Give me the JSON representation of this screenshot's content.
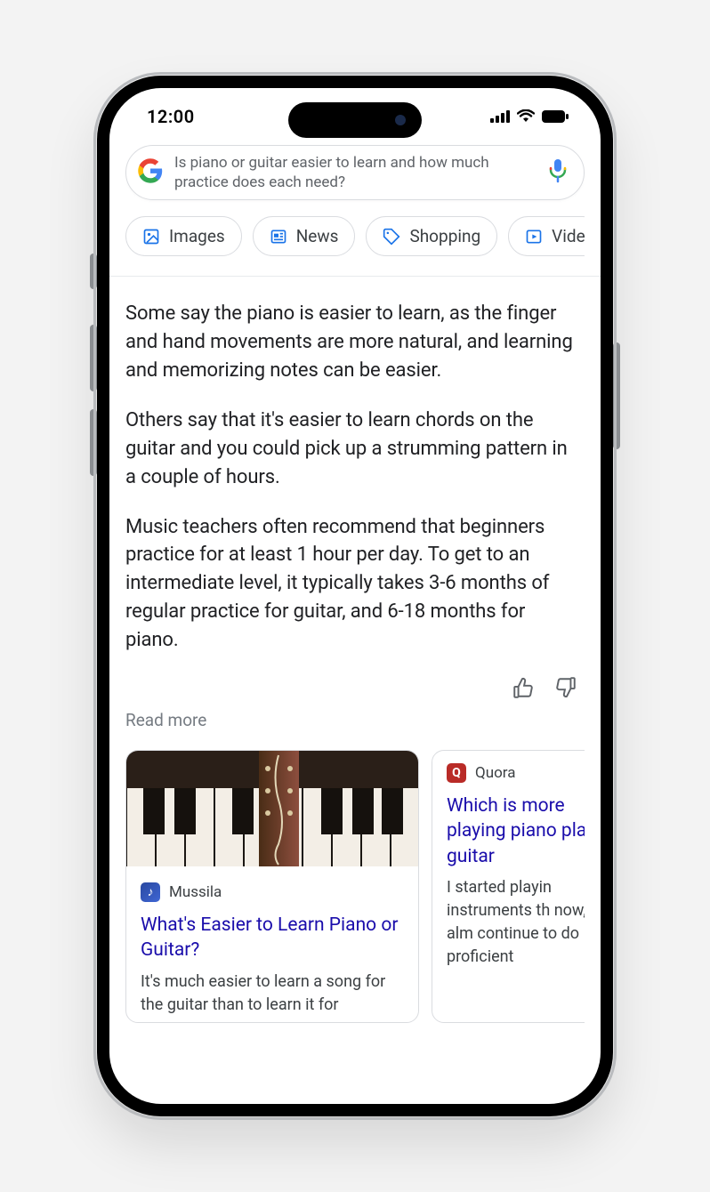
{
  "status": {
    "time": "12:00"
  },
  "search": {
    "query": "Is piano or guitar easier to learn and how much practice does each need?"
  },
  "chips": [
    {
      "id": "images",
      "label": "Images",
      "icon": "image-icon"
    },
    {
      "id": "news",
      "label": "News",
      "icon": "news-icon"
    },
    {
      "id": "shopping",
      "label": "Shopping",
      "icon": "tag-icon"
    },
    {
      "id": "videos",
      "label": "Vide",
      "icon": "play-icon"
    }
  ],
  "answer": {
    "paragraphs": [
      "Some say the piano is easier to learn, as the finger and hand movements are more natural, and learning and memorizing notes can be easier.",
      "Others say that it's easier to learn chords on the guitar and you could pick up a strumming pattern in a couple of hours.",
      "Music teachers often recommend that beginners practice for at least 1 hour per day. To get to an intermediate level, it typically takes 3-6 months of regular practice for guitar, and 6-18 months for piano."
    ],
    "read_more": "Read more"
  },
  "cards": [
    {
      "source": "Mussila",
      "favicon": "mussila",
      "has_image": true,
      "title": "What's Easier to Learn Piano or Guitar?",
      "snippet": "It's much easier to learn a song for the guitar than to learn it for"
    },
    {
      "source": "Quora",
      "favicon": "quora",
      "has_image": false,
      "title": "Which is more playing piano playing guitar",
      "snippet": "I started playin instruments th now, after alm continue to do proficient"
    }
  ]
}
